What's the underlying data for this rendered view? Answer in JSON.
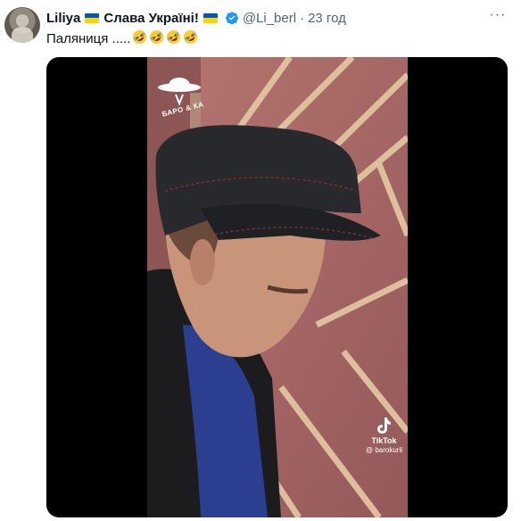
{
  "tweet": {
    "display_name": "Liliya",
    "name_suffix": "Слава Україні!",
    "handle": "@Li_berl",
    "time": "23 год",
    "text": "Паляниця .....",
    "emojis": [
      "rofl-emoji",
      "rofl-emoji",
      "rofl-emoji",
      "rofl-emoji"
    ],
    "more_label": "···"
  },
  "video": {
    "watermark_text": "БАРО & КА",
    "tiktok_label": "TikTok",
    "tiktok_user": "@ barokuril"
  },
  "colors": {
    "verified": "#1d9bf0",
    "flag_blue": "#0057b7",
    "flag_yellow": "#ffd700",
    "wall": "#a86a65",
    "muted_text": "#536471"
  }
}
